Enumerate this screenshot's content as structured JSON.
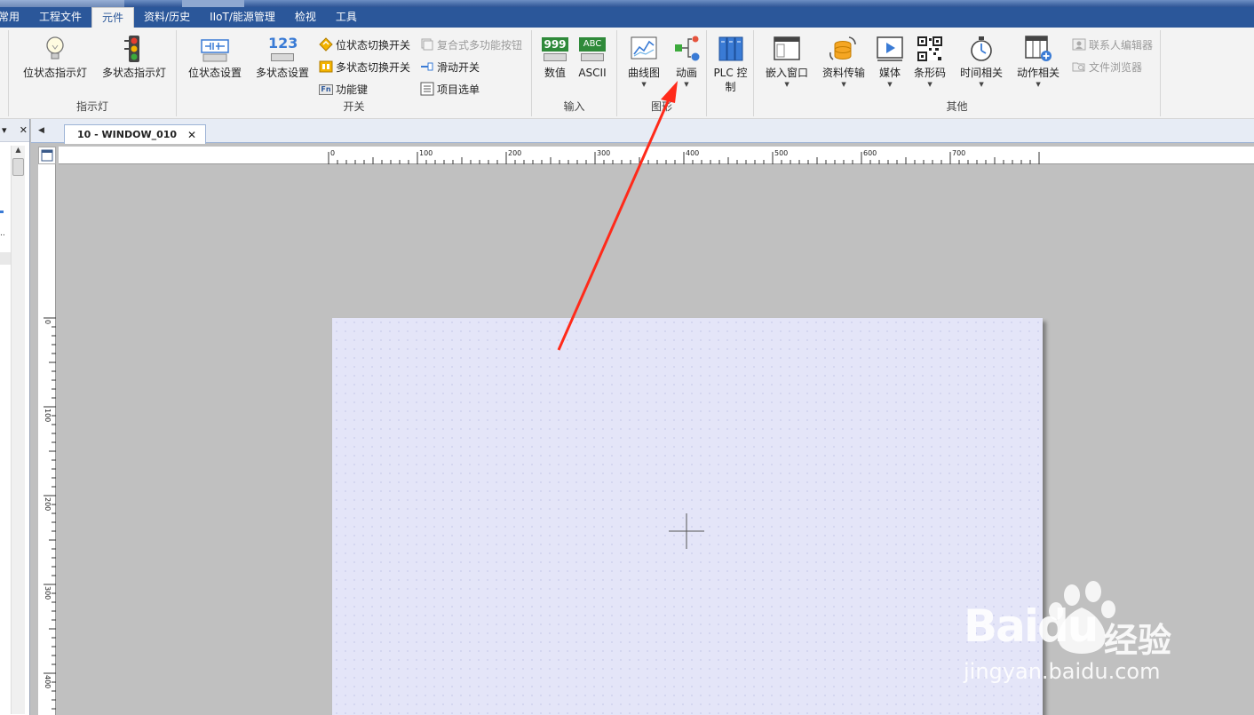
{
  "menu": {
    "items": [
      "常用",
      "工程文件",
      "元件",
      "资料/历史",
      "IIoT/能源管理",
      "检视",
      "工具"
    ],
    "active_index": 2
  },
  "ribbon": {
    "indicator": {
      "label": "指示灯",
      "bit_lamp": "位状态指示灯",
      "word_lamp": "多状态指示灯"
    },
    "switch": {
      "label": "开关",
      "bit_set": "位状态设置",
      "word_set": "多状态设置",
      "bit_toggle": "位状态切换开关",
      "word_toggle": "多状态切换开关",
      "function_key": "功能键",
      "combo_button": "复合式多功能按钮",
      "slide_switch": "滑动开关",
      "option_list": "项目选单",
      "icon_999": "999",
      "icon_123": "123",
      "icon_fn": "Fn"
    },
    "input": {
      "label": "输入",
      "numeric": "数值",
      "ascii": "ASCII",
      "icon_abc": "ABC"
    },
    "graph": {
      "label": "图形",
      "trend": "曲线图",
      "animation": "动画"
    },
    "plc": {
      "label": "PLC 控制"
    },
    "other": {
      "label": "其他",
      "embed_window": "嵌入窗口",
      "data_transfer": "资料传输",
      "media": "媒体",
      "barcode": "条形码",
      "time": "时间相关",
      "action": "动作相关",
      "contacts": "联系人编辑器",
      "file_browser": "文件浏览器"
    }
  },
  "tab": {
    "title": "10 - WINDOW_010",
    "close": "✕"
  },
  "panel": {
    "pin": "▾",
    "close": "✕"
  },
  "rulers": {
    "h_labels": [
      "0",
      "100",
      "200",
      "300",
      "400",
      "500",
      "600",
      "700"
    ],
    "v_labels": [
      "0",
      "100",
      "200",
      "300",
      "400"
    ]
  },
  "watermark": {
    "brand": "Baidu",
    "cn": "经验",
    "url": "jingyan.baidu.com"
  },
  "colors": {
    "menubar": "#2b579a",
    "ribbon": "#f3f3f3",
    "canvas": "#e4e5f8",
    "workspace": "#c0c0c0",
    "annotation_arrow": "#ff2a1a"
  }
}
